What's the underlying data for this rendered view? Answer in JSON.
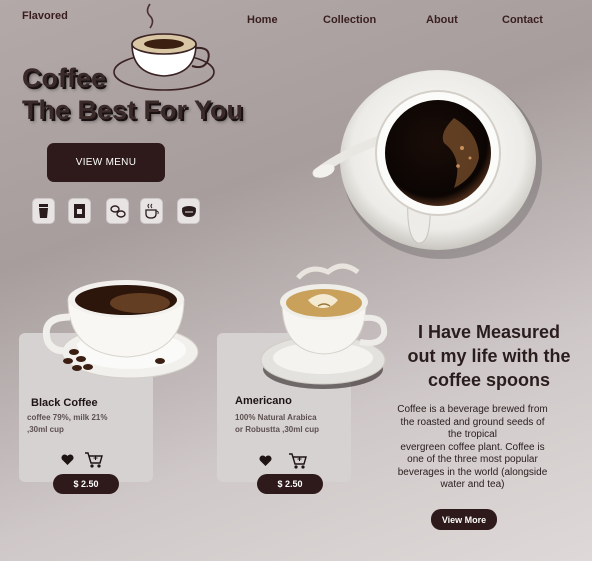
{
  "brand": "Flavored",
  "nav": {
    "home": "Home",
    "collection": "Collection",
    "about": "About",
    "contact": "Contact"
  },
  "hero": {
    "title_line1": "Coffee",
    "title_line2": "The Best For You",
    "cta": "VIEW MENU"
  },
  "icons": [
    "cup-icon",
    "coffee-machine-icon",
    "coffee-beans-icon",
    "steaming-cup-icon",
    "coffee-bowl-icon"
  ],
  "products": [
    {
      "name": "Black Coffee",
      "desc1": "coffee 79%, milk 21%",
      "desc2": ",30ml cup",
      "price": "$ 2.50"
    },
    {
      "name": "Americano",
      "desc1": "100% Natural Arabica",
      "desc2": "or Robustta ,30ml cup",
      "price": "$ 2.50"
    }
  ],
  "quote": {
    "line1": "I Have Measured",
    "line2": "out my life with the",
    "line3": "coffee spoons"
  },
  "about": {
    "l1": "Coffee is a beverage brewed from",
    "l2": "the roasted and ground seeds of",
    "l3": "the tropical",
    "l4": "evergreen coffee plant. Coffee is",
    "l5": "one of the three most popular",
    "l6": "beverages in the world (alongside",
    "l7": "water and tea)",
    "cta": "View More"
  },
  "colors": {
    "accent": "#2e1a1a",
    "card": "#d7d2d2"
  }
}
